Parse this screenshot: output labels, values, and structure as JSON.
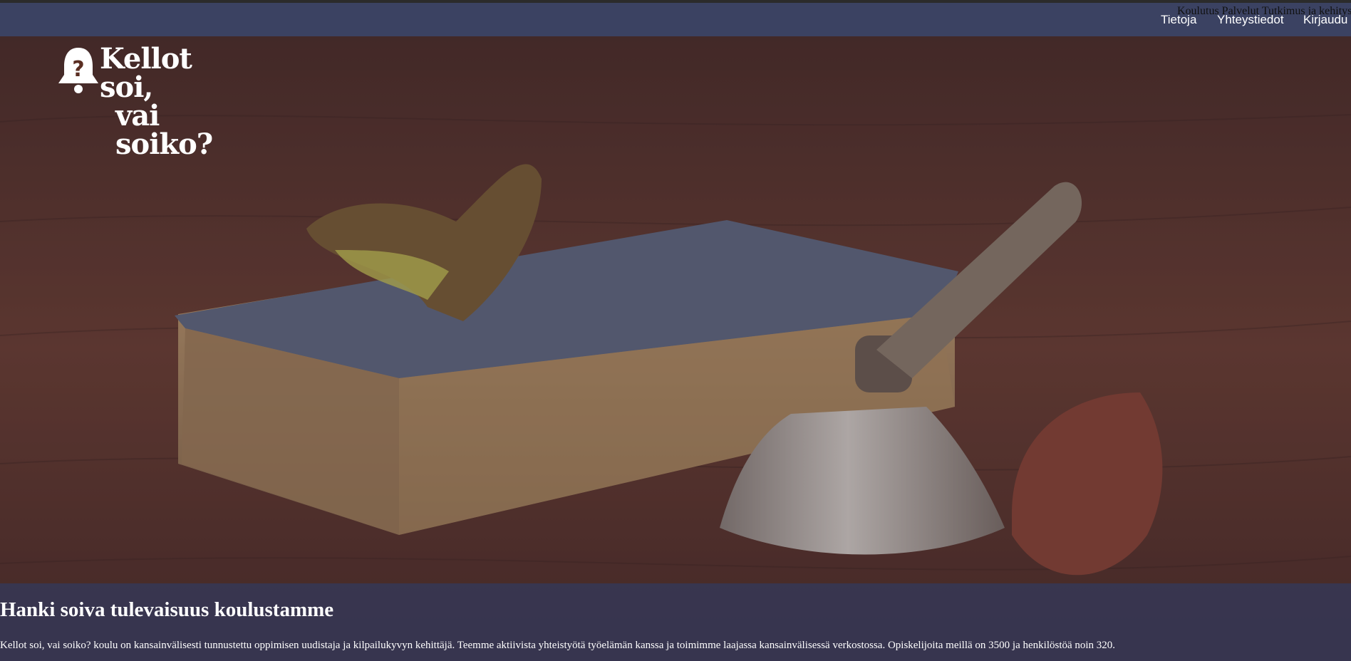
{
  "nav": {
    "overlay_text": "Koulutus Palvelut Tutkimus ja kehitys",
    "links": [
      "Tietoja",
      "Yhteystiedot",
      "Kirjaudu"
    ]
  },
  "logo": {
    "line1": "Kellot soi,",
    "line2": "vai soiko?",
    "icon": "bell-question-icon"
  },
  "hero": {
    "headline": "Hanki soiva tulevaisuus koulustamme",
    "intro": "Kellot soi, vai soiko? koulu on kansainvälisesti tunnustettu oppimisen uudistaja ja kilpailukyvyn kehittäjä. Teemme aktiivista yhteistyötä työelämän kanssa ja toimimme laajassa kansainvälisessä verkostossa. Opiskelijoita meillä on 3500 ja henkilöstöä noin 320."
  },
  "colors": {
    "navbar": "#3b4262",
    "band": "#343858",
    "wood": "#6a3a26"
  }
}
